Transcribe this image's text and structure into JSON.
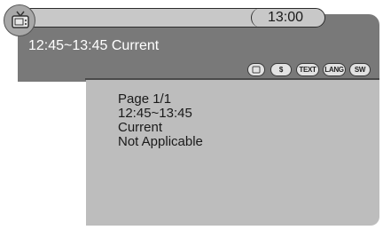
{
  "header": {
    "clock": "13:00",
    "program_title": "12:45~13:45 Current"
  },
  "feature_icons": [
    {
      "name": "subtitle-icon",
      "label": ""
    },
    {
      "name": "dollar-icon",
      "label": "$"
    },
    {
      "name": "text-icon",
      "label": "TEXT"
    },
    {
      "name": "lang-icon",
      "label": "LANG"
    },
    {
      "name": "sw-icon",
      "label": "SW"
    }
  ],
  "info": {
    "page": "Page 1/1",
    "time_range": "12:45~13:45",
    "status": "Current",
    "details": "Not Applicable"
  },
  "colors": {
    "header_bg": "#797979",
    "content_bg": "#bdbdbd",
    "pill_bg": "#c8c8c8"
  }
}
